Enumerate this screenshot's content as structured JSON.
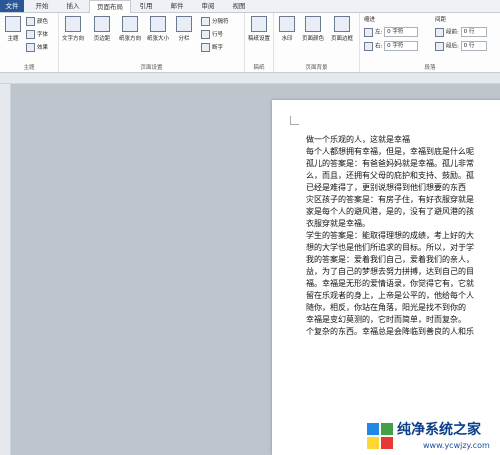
{
  "tabs": [
    "文件",
    "开始",
    "插入",
    "页面布局",
    "引用",
    "邮件",
    "审阅",
    "视图"
  ],
  "groups": {
    "theme": {
      "label": "主题",
      "main": "主题",
      "colors": "颜色",
      "fonts": "字体",
      "effects": "效果"
    },
    "page_setup": {
      "label": "页面设置",
      "buttons": [
        "文字方向",
        "页边距",
        "纸张方向",
        "纸张大小",
        "分栏"
      ],
      "separators": "分隔符",
      "line_numbers": "行号",
      "hyphenation": "断字"
    },
    "manuscript": {
      "label": "稿纸",
      "button": "稿纸设置"
    },
    "page_bg": {
      "label": "页面背景",
      "buttons": [
        "水印",
        "页面颜色",
        "页面边框"
      ]
    },
    "paragraph": {
      "label": "段落",
      "indent_header": "缩进",
      "spacing_header": "间距",
      "left_label": "左:",
      "left_value": "0 字符",
      "right_label": "右:",
      "right_value": "0 字符",
      "before_label": "段前:",
      "before_value": "0 行",
      "after_label": "段后:",
      "after_value": "0 行"
    }
  },
  "document": {
    "lines": [
      "做一个乐观的人，这就是幸福",
      "每个人都想拥有幸福，但是，幸福到底是什么呢",
      "孤儿的答案是：有爸爸妈妈就是幸福。孤儿非常",
      "么，而且，还拥有父母的庇护和支持、鼓励。孤",
      "已经是难得了，更别说想得到他们想要的东西",
      "灾区孩子的答案是：有房子住，有好衣服穿就是",
      "家是每个人的避风港，是的，没有了避风港的孩",
      "衣服穿就是幸福。",
      "学生的答案是：能取得理想的成绩，考上好的大",
      "想的大学也是他们所追求的目标。所以，对于学",
      "我的答案是：爱着我们自己，爱着我们的亲人，",
      "益，为了自己的梦想去努力拼搏，达到自己的目",
      "福。幸福是无形的爱情语录，你觉得它有，它就",
      "留在乐观者的身上，上帝是公平的，他给每个人",
      "随你，相反，你站在角落，阳光是找不到你的",
      "幸福是变幻莫测的，它时而简单，时而复杂。",
      "个复杂的东西。幸福总是会降临到善良的人和乐"
    ]
  },
  "watermark": {
    "title": "纯净系统之家",
    "url": "www.ycwjzy.com"
  }
}
